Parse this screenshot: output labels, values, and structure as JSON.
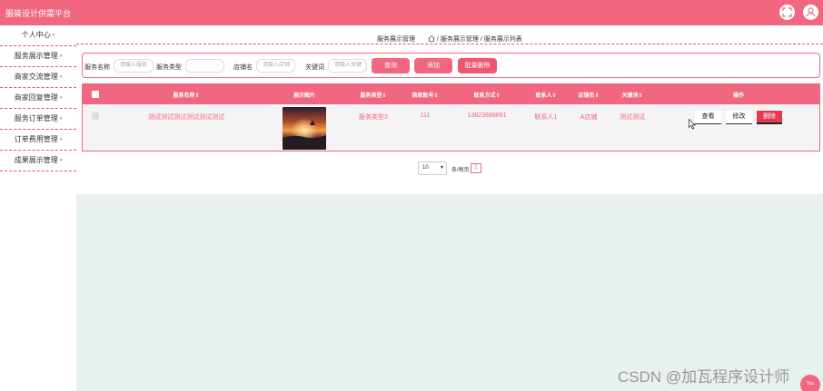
{
  "app": {
    "title": "服装设计供需平台",
    "accent_color": "#f0677f",
    "fullscreen_icon": "fullscreen-icon",
    "user_icon": "user-icon"
  },
  "sidebar": {
    "items": [
      {
        "label": "个人中心",
        "has_caret": true
      },
      {
        "label": "服务展示管理",
        "has_caret": true
      },
      {
        "label": "商家交流管理",
        "has_caret": true
      },
      {
        "label": "商家回复管理",
        "has_caret": true
      },
      {
        "label": "服务订单管理",
        "has_caret": true
      },
      {
        "label": "订单费用管理",
        "has_caret": true
      },
      {
        "label": "成果展示管理",
        "has_caret": true
      }
    ],
    "caret": "▾"
  },
  "breadcrumb": {
    "section": "服务展示管理",
    "path": "/ 服务展示管理 / 服务展示列表",
    "home_icon": "home-icon"
  },
  "search": {
    "name_label": "服务名称",
    "name_placeholder": "请输入服务",
    "type_label": "服务类型",
    "type_value": "",
    "shop_label": "店铺名",
    "shop_placeholder": "请输入店铺",
    "keyword_label": "关键词",
    "keyword_placeholder": "请输入关键",
    "search_button": "查询",
    "add_button": "添加",
    "batch_delete_button": "批量删除"
  },
  "table": {
    "columns": [
      "服务名称⇕",
      "展示图片",
      "服务类型⇕",
      "商家账号⇕",
      "联系方式⇕",
      "联系人⇕",
      "店铺名⇕",
      "关键词⇕",
      "操作"
    ],
    "rows": [
      {
        "name": "测试测试测试测试测试测试",
        "type": "服务类型3",
        "account": "111",
        "phone": "13823888881",
        "contact": "联系人1",
        "shop": "A店铺",
        "keyword": "测试测试",
        "actions": {
          "view": "查看",
          "edit": "修改",
          "delete": "删除"
        }
      }
    ]
  },
  "pager": {
    "page_size": "10",
    "page_size_caret": "▾",
    "per_page_label": "条/每页",
    "current_page": "1"
  },
  "watermark": "CSDN @加瓦程序设计师",
  "back_to_top": "Top"
}
